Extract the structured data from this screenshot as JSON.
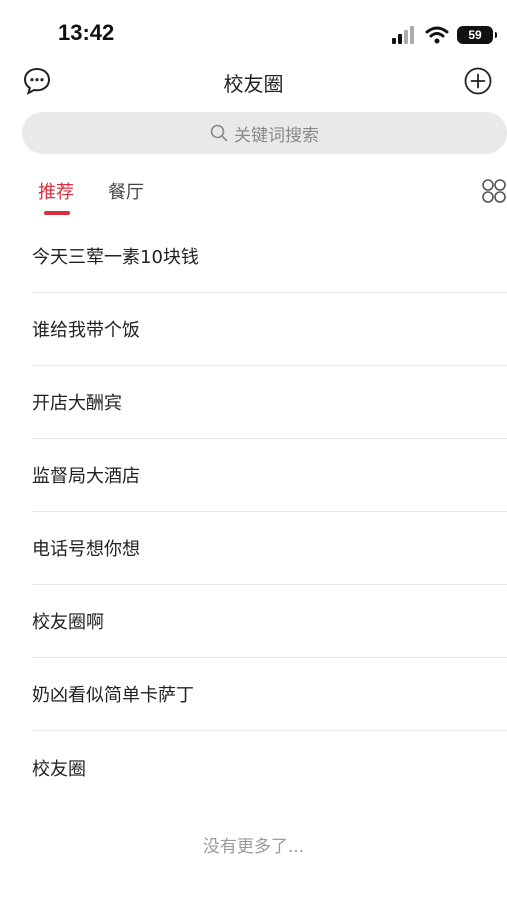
{
  "status_bar": {
    "time": "13:42",
    "battery": "59"
  },
  "header": {
    "title": "校友圈",
    "left_icon": "chat-bubble-icon",
    "right_icon": "plus-circle-icon"
  },
  "search": {
    "placeholder": "关键词搜索",
    "icon": "search-icon"
  },
  "tabs": [
    {
      "label": "推荐",
      "active": true
    },
    {
      "label": "餐厅",
      "active": false
    }
  ],
  "tabs_menu_icon": "grid-icon",
  "posts": [
    {
      "title": "今天三荤一素10块钱"
    },
    {
      "title": "谁给我带个饭"
    },
    {
      "title": "开店大酬宾"
    },
    {
      "title": "监督局大酒店"
    },
    {
      "title": "电话号想你想"
    },
    {
      "title": "校友圈啊"
    },
    {
      "title": "奶凶看似简单卡萨丁"
    },
    {
      "title": "校友圈"
    }
  ],
  "footer_text": "没有更多了...",
  "colors": {
    "accent": "#d6303c",
    "search_bg": "#e9e9e9",
    "divider": "#e8e8e8",
    "muted_text": "#9a9a9a"
  }
}
